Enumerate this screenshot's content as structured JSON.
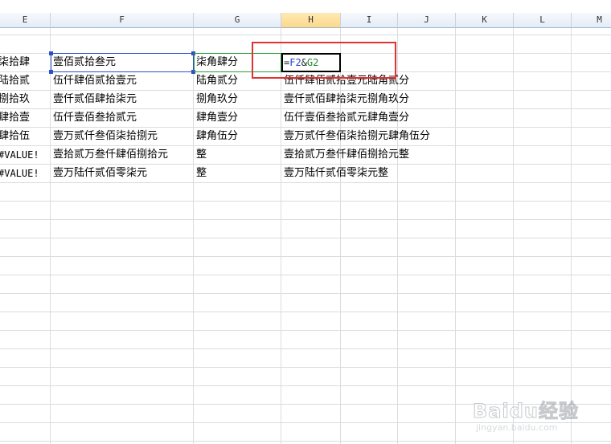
{
  "columns": [
    "E",
    "F",
    "G",
    "H",
    "I",
    "J",
    "K",
    "L",
    "M"
  ],
  "active_column": "H",
  "rows": [
    {
      "e": "柒拾肆",
      "f": "壹佰贰拾叁元",
      "g": "柒角肆分",
      "h": ""
    },
    {
      "e": "陆拾贰",
      "f": "伍仟肆佰贰拾壹元",
      "g": "陆角贰分",
      "h": "伍仟肆佰贰拾壹元陆角贰分"
    },
    {
      "e": "捌拾玖",
      "f": "壹仟贰佰肆拾柒元",
      "g": "捌角玖分",
      "h": "壹仟贰佰肆拾柒元捌角玖分"
    },
    {
      "e": "肆拾壹",
      "f": "伍仟壹佰叁拾贰元",
      "g": "肆角壹分",
      "h": "伍仟壹佰叁拾贰元肆角壹分"
    },
    {
      "e": "肆拾伍",
      "f": "壹万贰仟叁佰柒拾捌元",
      "g": "肆角伍分",
      "h": "壹万贰仟叁佰柒拾捌元肆角伍分"
    },
    {
      "e": "#VALUE!",
      "f": "壹拾贰万叁仟肆佰捌拾元",
      "g": "整",
      "h": "壹拾贰万叁仟肆佰捌拾元整"
    },
    {
      "e": "#VALUE!",
      "f": "壹万陆仟贰佰零柒元",
      "g": "整",
      "h": "壹万陆仟贰佰零柒元整"
    }
  ],
  "formula": {
    "prefix": "=",
    "ref1": "F2",
    "op": "&",
    "ref2": "G2"
  },
  "watermark": {
    "main": "Baidu经验",
    "sub": "jingyan.baidu.com"
  }
}
